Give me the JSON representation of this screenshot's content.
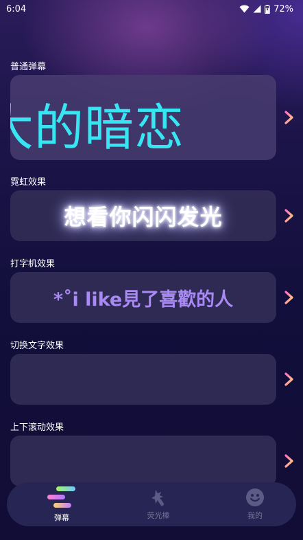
{
  "status_bar": {
    "time": "6:04",
    "battery": "72%",
    "icons": [
      "wifi-icon",
      "signal-icon",
      "battery-icon"
    ]
  },
  "sections": [
    {
      "label": "普通弹幕",
      "preview_text": "大的暗恋",
      "preview_color": "#37e6f2"
    },
    {
      "label": "霓虹效果",
      "preview_text": "想看你闪闪发光",
      "preview_color": "#ffffff"
    },
    {
      "label": "打字机效果",
      "preview_text": "*˚i like見了喜歡的人",
      "preview_color": "#a98af5"
    },
    {
      "label": "切换文字效果",
      "preview_text": ""
    },
    {
      "label": "上下滚动效果",
      "preview_text": ""
    }
  ],
  "bottom_nav": {
    "items": [
      {
        "label": "弹幕",
        "icon": "danmaku-icon",
        "active": true
      },
      {
        "label": "荧光棒",
        "icon": "glow-stick-icon",
        "active": false
      },
      {
        "label": "我的",
        "icon": "profile-smile-icon",
        "active": false
      }
    ]
  },
  "colors": {
    "background": "#130f3c",
    "card": "#322c56",
    "chevron_gradient": [
      "#ff6ec7",
      "#ffd36e"
    ],
    "nav_bar": "#272553"
  }
}
